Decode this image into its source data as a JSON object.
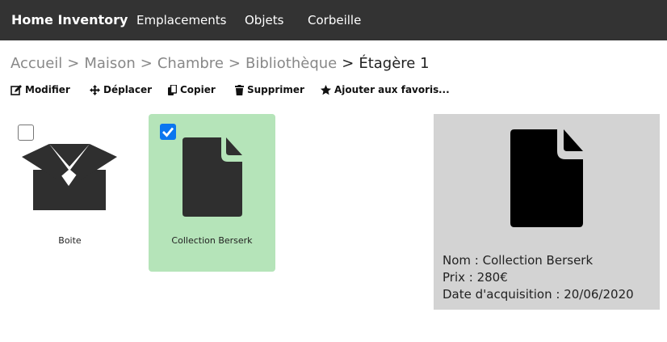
{
  "navbar": {
    "brand": "Home Inventory",
    "links": [
      "Emplacements",
      "Objets",
      "Corbeille"
    ]
  },
  "breadcrumb": {
    "items": [
      "Accueil",
      "Maison",
      "Chambre",
      "Bibliothèque"
    ],
    "current": "Étagère 1",
    "separator": ">"
  },
  "toolbar": {
    "modifier": "Modifier",
    "deplacer": "Déplacer",
    "copier": "Copier",
    "supprimer": "Supprimer",
    "favoris": "Ajouter aux favoris",
    "more": "..."
  },
  "items": [
    {
      "label": "Boite",
      "icon": "box-icon",
      "checked": false
    },
    {
      "label": "Collection Berserk",
      "icon": "file-icon",
      "checked": true
    }
  ],
  "details": {
    "icon": "file-icon",
    "nom": "Nom : Collection Berserk",
    "prix": "Prix : 280€",
    "date": "Date d'acquisition : 20/06/2020"
  },
  "colors": {
    "navbar": "#333333",
    "selected_item": "#b5e4b9",
    "details_bg": "#d3d3d3",
    "checkbox": "#0b76ef"
  }
}
